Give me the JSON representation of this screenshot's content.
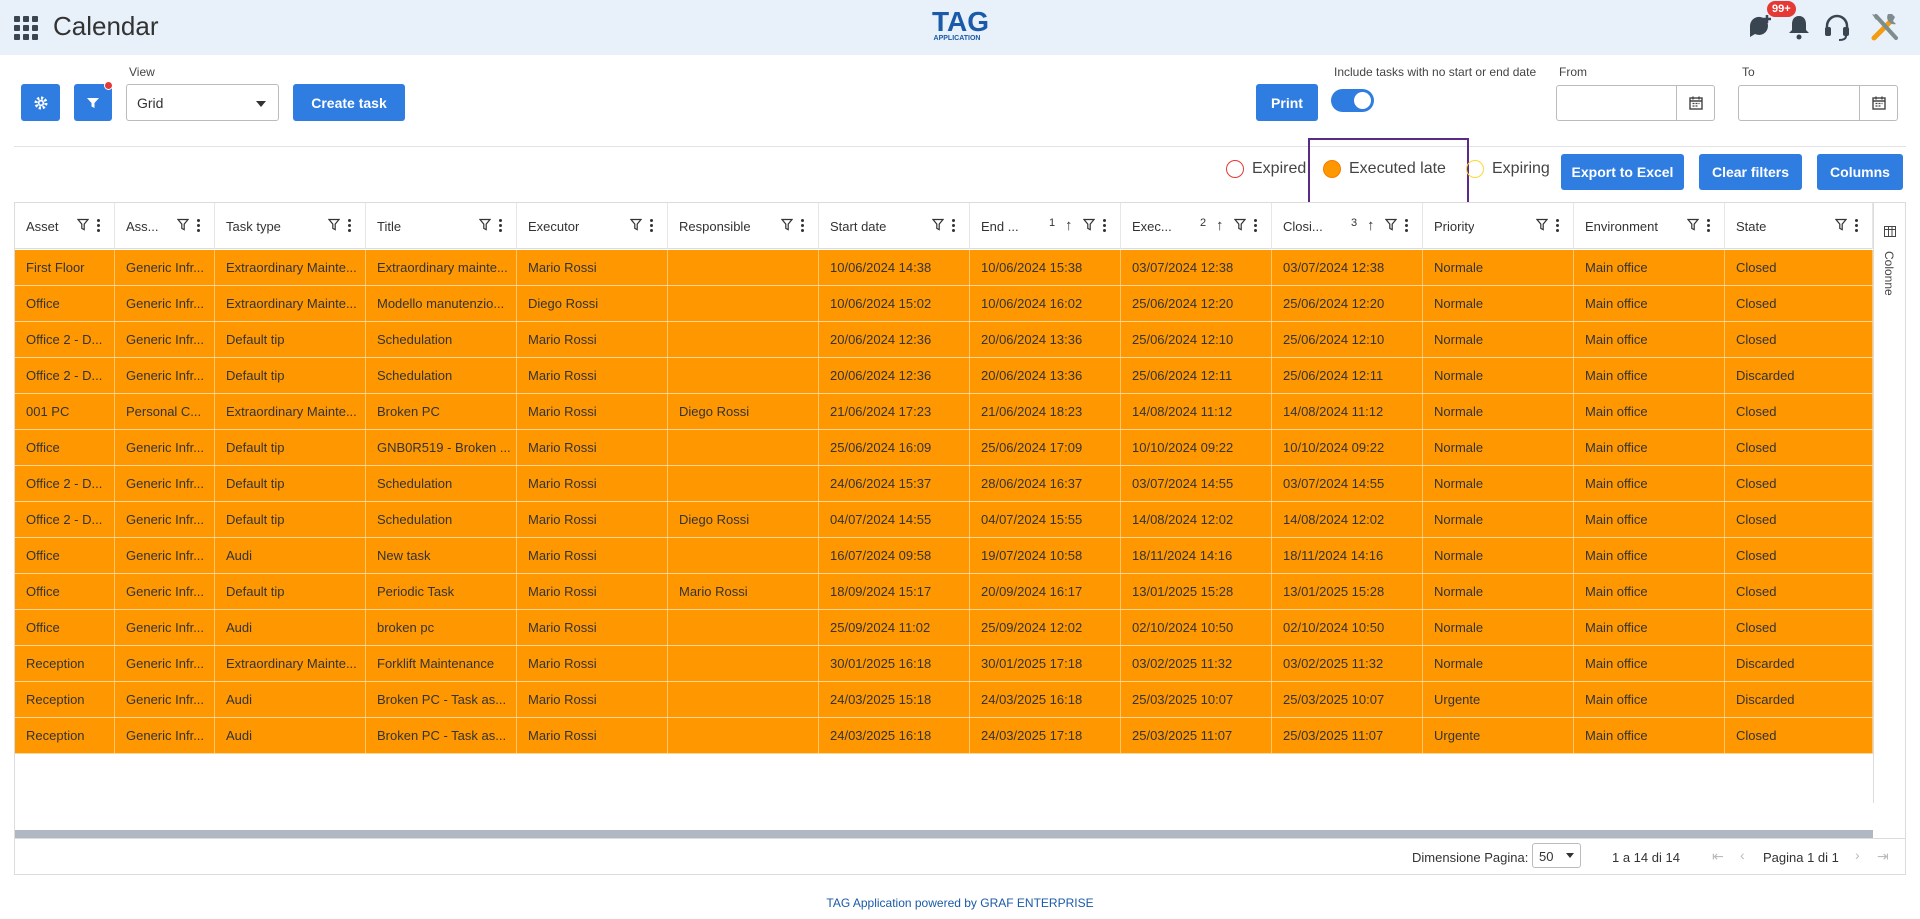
{
  "header": {
    "app_title": "Calendar",
    "logo_text": "TAG",
    "logo_subtext": "APPLICATION",
    "notification_badge": "99+",
    "icons": [
      "apps-grid-icon",
      "add-feedback-icon",
      "bell-icon",
      "headset-icon",
      "tools-icon"
    ]
  },
  "toolbar": {
    "view_label": "View",
    "view_value": "Grid",
    "create_task_label": "Create task",
    "print_label": "Print",
    "include_label": "Include tasks with no start or end date",
    "include_on": true,
    "from_label": "From",
    "to_label": "To",
    "from_value": "",
    "to_value": ""
  },
  "legend": {
    "expired": "Expired",
    "executed_late": "Executed late",
    "expiring": "Expiring",
    "colors": {
      "expired": "#e53935",
      "executed_late": "#ff9800",
      "expiring": "#fdd835"
    }
  },
  "actions": {
    "export_label": "Export to Excel",
    "clear_filters_label": "Clear filters",
    "columns_label": "Columns"
  },
  "grid": {
    "columns": [
      {
        "label": "Asset",
        "sort": ""
      },
      {
        "label": "Ass...",
        "sort": ""
      },
      {
        "label": "Task type",
        "sort": ""
      },
      {
        "label": "Title",
        "sort": ""
      },
      {
        "label": "Executor",
        "sort": ""
      },
      {
        "label": "Responsible",
        "sort": ""
      },
      {
        "label": "Start date",
        "sort": ""
      },
      {
        "label": "End ...",
        "sort": "1"
      },
      {
        "label": "Exec...",
        "sort": "2"
      },
      {
        "label": "Closi...",
        "sort": "3"
      },
      {
        "label": "Priority",
        "sort": ""
      },
      {
        "label": "Environment",
        "sort": ""
      },
      {
        "label": "State",
        "sort": ""
      }
    ],
    "rows": [
      [
        "First Floor",
        "Generic Infr...",
        "Extraordinary Mainte...",
        "Extraordinary mainte...",
        "Mario Rossi",
        "",
        "10/06/2024 14:38",
        "10/06/2024 15:38",
        "03/07/2024 12:38",
        "03/07/2024 12:38",
        "Normale",
        "Main office",
        "Closed"
      ],
      [
        "Office",
        "Generic Infr...",
        "Extraordinary Mainte...",
        "Modello manutenzio...",
        "Diego Rossi",
        "",
        "10/06/2024 15:02",
        "10/06/2024 16:02",
        "25/06/2024 12:20",
        "25/06/2024 12:20",
        "Normale",
        "Main office",
        "Closed"
      ],
      [
        "Office 2 - D...",
        "Generic Infr...",
        "Default tip",
        "Schedulation",
        "Mario Rossi",
        "",
        "20/06/2024 12:36",
        "20/06/2024 13:36",
        "25/06/2024 12:10",
        "25/06/2024 12:10",
        "Normale",
        "Main office",
        "Closed"
      ],
      [
        "Office 2 - D...",
        "Generic Infr...",
        "Default tip",
        "Schedulation",
        "Mario Rossi",
        "",
        "20/06/2024 12:36",
        "20/06/2024 13:36",
        "25/06/2024 12:11",
        "25/06/2024 12:11",
        "Normale",
        "Main office",
        "Discarded"
      ],
      [
        "001 PC",
        "Personal C...",
        "Extraordinary Mainte...",
        "Broken PC",
        "Mario Rossi",
        "Diego Rossi",
        "21/06/2024 17:23",
        "21/06/2024 18:23",
        "14/08/2024 11:12",
        "14/08/2024 11:12",
        "Normale",
        "Main office",
        "Closed"
      ],
      [
        "Office",
        "Generic Infr...",
        "Default tip",
        "GNB0R519 - Broken ...",
        "Mario Rossi",
        "",
        "25/06/2024 16:09",
        "25/06/2024 17:09",
        "10/10/2024 09:22",
        "10/10/2024 09:22",
        "Normale",
        "Main office",
        "Closed"
      ],
      [
        "Office 2 - D...",
        "Generic Infr...",
        "Default tip",
        "Schedulation",
        "Mario Rossi",
        "",
        "24/06/2024 15:37",
        "28/06/2024 16:37",
        "03/07/2024 14:55",
        "03/07/2024 14:55",
        "Normale",
        "Main office",
        "Closed"
      ],
      [
        "Office 2 - D...",
        "Generic Infr...",
        "Default tip",
        "Schedulation",
        "Mario Rossi",
        "Diego Rossi",
        "04/07/2024 14:55",
        "04/07/2024 15:55",
        "14/08/2024 12:02",
        "14/08/2024 12:02",
        "Normale",
        "Main office",
        "Closed"
      ],
      [
        "Office",
        "Generic Infr...",
        "Audi",
        "New task",
        "Mario Rossi",
        "",
        "16/07/2024 09:58",
        "19/07/2024 10:58",
        "18/11/2024 14:16",
        "18/11/2024 14:16",
        "Normale",
        "Main office",
        "Closed"
      ],
      [
        "Office",
        "Generic Infr...",
        "Default tip",
        "Periodic Task",
        "Mario Rossi",
        "Mario Rossi",
        "18/09/2024 15:17",
        "20/09/2024 16:17",
        "13/01/2025 15:28",
        "13/01/2025 15:28",
        "Normale",
        "Main office",
        "Closed"
      ],
      [
        "Office",
        "Generic Infr...",
        "Audi",
        "broken pc",
        "Mario Rossi",
        "",
        "25/09/2024 11:02",
        "25/09/2024 12:02",
        "02/10/2024 10:50",
        "02/10/2024 10:50",
        "Normale",
        "Main office",
        "Closed"
      ],
      [
        "Reception",
        "Generic Infr...",
        "Extraordinary Mainte...",
        "Forklift Maintenance",
        "Mario Rossi",
        "",
        "30/01/2025 16:18",
        "30/01/2025 17:18",
        "03/02/2025 11:32",
        "03/02/2025 11:32",
        "Normale",
        "Main office",
        "Discarded"
      ],
      [
        "Reception",
        "Generic Infr...",
        "Audi",
        "Broken PC - Task as...",
        "Mario Rossi",
        "",
        "24/03/2025 15:18",
        "24/03/2025 16:18",
        "25/03/2025 10:07",
        "25/03/2025 10:07",
        "Urgente",
        "Main office",
        "Discarded"
      ],
      [
        "Reception",
        "Generic Infr...",
        "Audi",
        "Broken PC - Task as...",
        "Mario Rossi",
        "",
        "24/03/2025 16:18",
        "24/03/2025 17:18",
        "25/03/2025 11:07",
        "25/03/2025 11:07",
        "Urgente",
        "Main office",
        "Closed"
      ]
    ],
    "row_color": "#ff9800",
    "side_panel_label": "Colonne"
  },
  "pagination": {
    "page_size_label": "Dimensione Pagina:",
    "page_size_value": "50",
    "range_text": "1 a 14 di 14",
    "page_text": "Pagina 1 di 1"
  },
  "footer": {
    "powered_by": "TAG Application powered by GRAF ENTERPRISE"
  }
}
